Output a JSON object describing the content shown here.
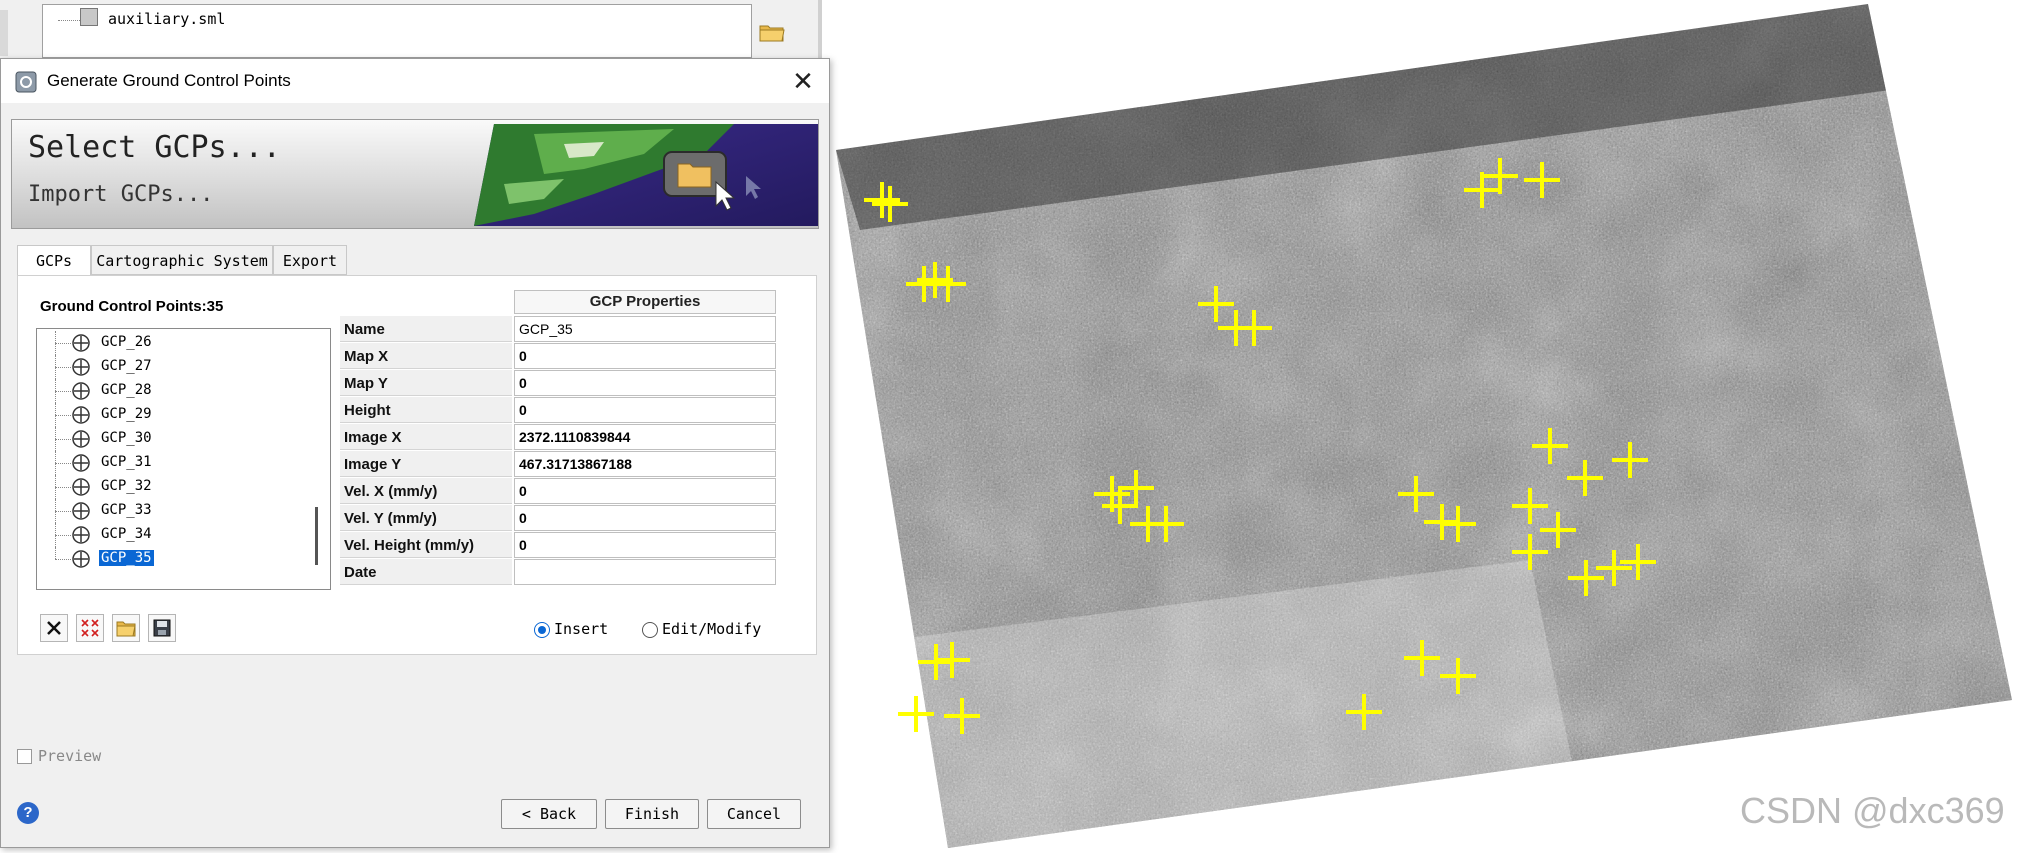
{
  "background": {
    "file_label": "auxiliary.sml"
  },
  "dialog": {
    "title": "Generate Ground Control Points",
    "banner_title": "Select GCPs...",
    "banner_subtitle": "Import GCPs...",
    "tabs": [
      "GCPs",
      "Cartographic System",
      "Export"
    ],
    "active_tab": "GCPs",
    "gcp_count_label": "Ground Control Points:35",
    "gcp_list": [
      "GCP_26",
      "GCP_27",
      "GCP_28",
      "GCP_29",
      "GCP_30",
      "GCP_31",
      "GCP_32",
      "GCP_33",
      "GCP_34",
      "GCP_35"
    ],
    "selected_gcp": "GCP_35",
    "properties_header": "GCP Properties",
    "properties": [
      {
        "key": "Name",
        "value": "GCP_35"
      },
      {
        "key": "Map X",
        "value": "0"
      },
      {
        "key": "Map Y",
        "value": "0"
      },
      {
        "key": "Height",
        "value": "0"
      },
      {
        "key": "Image X",
        "value": "2372.1110839844"
      },
      {
        "key": "Image Y",
        "value": "467.31713867188"
      },
      {
        "key": "Vel. X (mm/y)",
        "value": "0"
      },
      {
        "key": "Vel. Y (mm/y)",
        "value": "0"
      },
      {
        "key": "Vel. Height (mm/y)",
        "value": "0"
      },
      {
        "key": "Date",
        "value": ""
      }
    ],
    "toolbar_icons": [
      "delete-icon",
      "delete-all-icon",
      "open-folder-icon",
      "save-icon"
    ],
    "mode_options": [
      "Insert",
      "Edit/Modify"
    ],
    "mode_selected": "Insert",
    "preview_label": "Preview",
    "preview_checked": false,
    "buttons": {
      "back": "< Back",
      "finish": "Finish",
      "cancel": "Cancel"
    }
  },
  "image": {
    "marker_color": "#ffff00",
    "marker_count": 35
  },
  "watermark": "CSDN @dxc369"
}
